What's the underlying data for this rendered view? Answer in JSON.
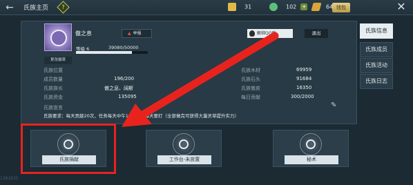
{
  "topbar": {
    "back_icon": "back-arrow-icon",
    "title": "氏族主页",
    "help_icon": "question-icon",
    "resources": [
      {
        "icon": "gold-bar-icon",
        "value": "31",
        "color": "#e2b84a"
      },
      {
        "icon": "jade-icon",
        "value": "102",
        "color": "#5bc079"
      },
      {
        "icon": "feather-coin-icon",
        "value": "6450",
        "color": "#d9a53a"
      }
    ],
    "wallet_label": "钱包",
    "close_icon": "close-icon"
  },
  "clan": {
    "name": "傲之息",
    "report_label": "举报",
    "bind_qq_label": "解绑QQ群",
    "quit_label": "退出",
    "level_label": "等级 6",
    "exp_text": "39080/50000",
    "exp_fraction": 0.7816,
    "change_emblem_label": "更改徽章"
  },
  "stats_left": [
    {
      "label": "氏族位置",
      "value": ""
    },
    {
      "label": "成员数量",
      "value": "196/200"
    },
    {
      "label": "氏族族长",
      "value": "傲之息、阔斯"
    },
    {
      "label": "氏族资金",
      "value": "135095"
    }
  ],
  "stats_right": [
    {
      "label": "氏族木材",
      "value": "69959"
    },
    {
      "label": "氏族石头",
      "value": "91684"
    },
    {
      "label": "氏族傲皮",
      "value": "16350"
    },
    {
      "label": "每日贡献",
      "value": "300/2000"
    }
  ],
  "announcement": {
    "label": "氏族宣言",
    "text": "氏族要求：每天贡献20次，任务每天中午12点守护每天要打（全部做完可获得大量灵草提升实力）"
  },
  "side_tabs": [
    {
      "label": "氏族信息",
      "active": true
    },
    {
      "label": "氏族成员",
      "active": false
    },
    {
      "label": "氏族活动",
      "active": false
    },
    {
      "label": "氏族日志",
      "active": false
    }
  ],
  "cards": [
    {
      "label": "氏族捐献",
      "icon": "donate-swirl-icon"
    },
    {
      "label": "工作台-未放置",
      "icon": "workbench-icon"
    },
    {
      "label": "秘术",
      "icon": "secret-art-icon"
    }
  ],
  "id_text": "1382635",
  "colors": {
    "highlight": "#e8231e",
    "arrow": "#e8231e"
  }
}
